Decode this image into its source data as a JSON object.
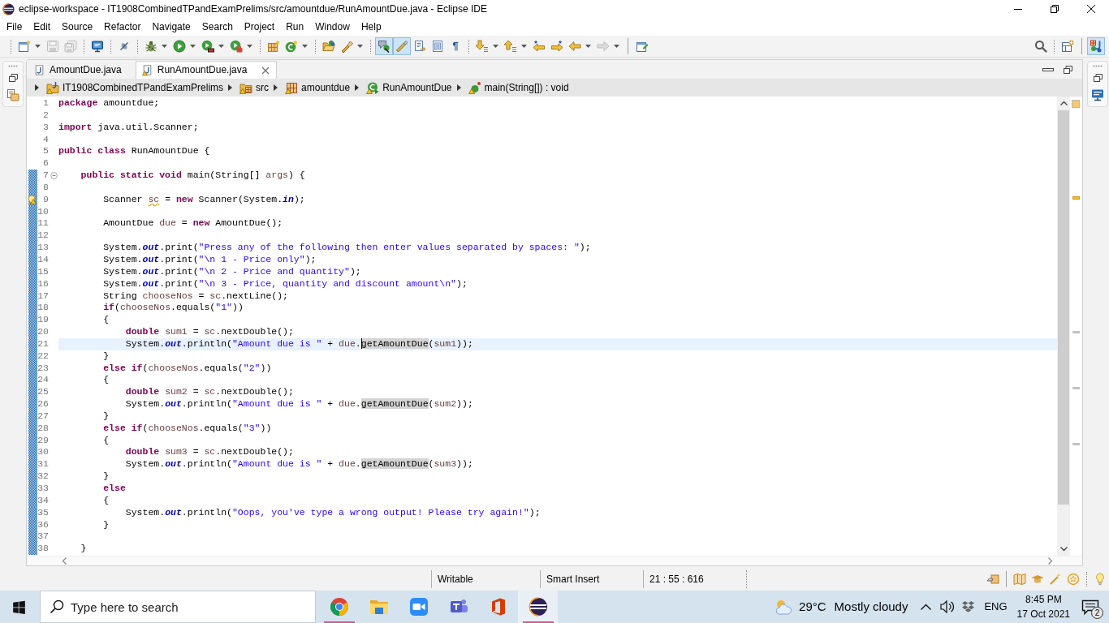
{
  "window": {
    "title": "eclipse-workspace - IT1908CombinedTPandExamPrelims/src/amountdue/RunAmountDue.java - Eclipse IDE"
  },
  "menu": [
    "File",
    "Edit",
    "Source",
    "Refactor",
    "Navigate",
    "Search",
    "Project",
    "Run",
    "Window",
    "Help"
  ],
  "toolbar": {
    "buttons": [
      {
        "kind": "icon",
        "disabled": false,
        "selected": false
      },
      {
        "kind": "icon",
        "disabled": true,
        "selected": false
      },
      {
        "kind": "icon",
        "disabled": true,
        "selected": false
      },
      {
        "kind": "icon",
        "disabled": false,
        "selected": false
      },
      {
        "kind": "icon",
        "disabled": false,
        "selected": false
      },
      {
        "kind": "icon",
        "disabled": false,
        "selected": false
      },
      {
        "kind": "icon",
        "disabled": false,
        "selected": false
      },
      {
        "kind": "icon",
        "disabled": false,
        "selected": false
      },
      {
        "kind": "icon",
        "disabled": false,
        "selected": false
      },
      {
        "kind": "icon",
        "disabled": false,
        "selected": false
      },
      {
        "kind": "icon",
        "disabled": false,
        "selected": false
      },
      {
        "kind": "icon",
        "disabled": false,
        "selected": false
      },
      {
        "kind": "icon",
        "disabled": false,
        "selected": false
      },
      {
        "kind": "icon",
        "disabled": false,
        "selected": true
      },
      {
        "kind": "icon",
        "disabled": false,
        "selected": true
      },
      {
        "kind": "icon",
        "disabled": false,
        "selected": false
      },
      {
        "kind": "icon",
        "disabled": false,
        "selected": false
      },
      {
        "kind": "glyph",
        "label": "¶",
        "disabled": false,
        "selected": false
      },
      {
        "kind": "icon",
        "disabled": false,
        "selected": false
      },
      {
        "kind": "icon",
        "disabled": false,
        "selected": false
      },
      {
        "kind": "icon",
        "disabled": false,
        "selected": false
      },
      {
        "kind": "icon",
        "disabled": false,
        "selected": false
      },
      {
        "kind": "icon",
        "disabled": false,
        "selected": false
      },
      {
        "kind": "icon",
        "disabled": true,
        "selected": false
      },
      {
        "kind": "icon",
        "disabled": false,
        "selected": false
      }
    ],
    "right_buttons": [
      {
        "kind": "icon",
        "disabled": false,
        "selected": false
      },
      {
        "kind": "icon",
        "disabled": false,
        "selected": false
      },
      {
        "kind": "icon",
        "disabled": false,
        "selected": true
      }
    ]
  },
  "editor_tabs": [
    {
      "label": "AmountDue.java",
      "selected": false,
      "warning": false
    },
    {
      "label": "RunAmountDue.java",
      "selected": true,
      "warning": true
    }
  ],
  "breadcrumb": [
    {
      "label": "IT1908CombinedTPandExamPrelims",
      "warning": true
    },
    {
      "label": "src",
      "warning": true
    },
    {
      "label": "amountdue",
      "warning": true
    },
    {
      "label": "RunAmountDue",
      "warning": true
    },
    {
      "label": "main(String[]) : void",
      "warning": true
    }
  ],
  "code": {
    "lines": [
      {
        "number": "1",
        "changed": false,
        "fold": false,
        "current": false,
        "segments": [
          {
            "kind": "keyword",
            "text": "package"
          },
          {
            "kind": "plain",
            "text": " amountdue;"
          }
        ]
      },
      {
        "number": "2",
        "changed": false,
        "fold": false,
        "current": false
      },
      {
        "number": "3",
        "changed": false,
        "fold": false,
        "current": false,
        "segments": [
          {
            "kind": "keyword",
            "text": "import"
          },
          {
            "kind": "plain",
            "text": " java.util.Scanner;"
          }
        ]
      },
      {
        "number": "4",
        "changed": false,
        "fold": false,
        "current": false
      },
      {
        "number": "5",
        "changed": false,
        "fold": false,
        "current": false,
        "segments": [
          {
            "kind": "keyword",
            "text": "public class"
          },
          {
            "kind": "plain",
            "text": " RunAmountDue {"
          }
        ]
      },
      {
        "number": "6",
        "changed": false,
        "fold": false,
        "current": false
      },
      {
        "number": "7",
        "changed": true,
        "fold": true,
        "current": false,
        "segments": [
          {
            "kind": "keyword",
            "text": "    public static void"
          },
          {
            "kind": "plain",
            "text": " main(String[] "
          },
          {
            "kind": "local",
            "text": "args"
          },
          {
            "kind": "plain",
            "text": ") {"
          }
        ]
      },
      {
        "number": "8",
        "changed": true,
        "fold": false,
        "current": false
      },
      {
        "number": "9",
        "changed": true,
        "fold": false,
        "current": false,
        "segments": [
          {
            "kind": "plain",
            "text": "        Scanner "
          },
          {
            "kind": "local_warning",
            "text": "sc"
          },
          {
            "kind": "plain",
            "text": " = "
          },
          {
            "kind": "keyword",
            "text": "new"
          },
          {
            "kind": "plain",
            "text": " Scanner(System."
          },
          {
            "kind": "field",
            "text": "in"
          },
          {
            "kind": "plain",
            "text": ");"
          }
        ]
      },
      {
        "number": "10",
        "changed": true,
        "fold": false,
        "current": false
      },
      {
        "number": "11",
        "changed": true,
        "fold": false,
        "current": false,
        "segments": [
          {
            "kind": "plain",
            "text": "        AmountDue "
          },
          {
            "kind": "local",
            "text": "due"
          },
          {
            "kind": "plain",
            "text": " = "
          },
          {
            "kind": "keyword",
            "text": "new"
          },
          {
            "kind": "plain",
            "text": " AmountDue();"
          }
        ]
      },
      {
        "number": "12",
        "changed": true,
        "fold": false,
        "current": false
      },
      {
        "number": "13",
        "changed": true,
        "fold": false,
        "current": false,
        "segments": [
          {
            "kind": "plain",
            "text": "        System."
          },
          {
            "kind": "field",
            "text": "out"
          },
          {
            "kind": "plain",
            "text": ".print("
          },
          {
            "kind": "string",
            "text": "\"Press any of the following then enter values separated by spaces: \""
          },
          {
            "kind": "plain",
            "text": ");"
          }
        ]
      },
      {
        "number": "14",
        "changed": true,
        "fold": false,
        "current": false,
        "segments": [
          {
            "kind": "plain",
            "text": "        System."
          },
          {
            "kind": "field",
            "text": "out"
          },
          {
            "kind": "plain",
            "text": ".print("
          },
          {
            "kind": "string",
            "text": "\"\\n 1 - Price only\""
          },
          {
            "kind": "plain",
            "text": ");"
          }
        ]
      },
      {
        "number": "15",
        "changed": true,
        "fold": false,
        "current": false,
        "segments": [
          {
            "kind": "plain",
            "text": "        System."
          },
          {
            "kind": "field",
            "text": "out"
          },
          {
            "kind": "plain",
            "text": ".print("
          },
          {
            "kind": "string",
            "text": "\"\\n 2 - Price and quantity\""
          },
          {
            "kind": "plain",
            "text": ");"
          }
        ]
      },
      {
        "number": "16",
        "changed": true,
        "fold": false,
        "current": false,
        "segments": [
          {
            "kind": "plain",
            "text": "        System."
          },
          {
            "kind": "field",
            "text": "out"
          },
          {
            "kind": "plain",
            "text": ".print("
          },
          {
            "kind": "string",
            "text": "\"\\n 3 - Price, quantity and discount amount\\n\""
          },
          {
            "kind": "plain",
            "text": ");"
          }
        ]
      },
      {
        "number": "17",
        "changed": true,
        "fold": false,
        "current": false,
        "segments": [
          {
            "kind": "plain",
            "text": "        String "
          },
          {
            "kind": "local",
            "text": "chooseNos"
          },
          {
            "kind": "plain",
            "text": " = "
          },
          {
            "kind": "local",
            "text": "sc"
          },
          {
            "kind": "plain",
            "text": ".nextLine();"
          }
        ]
      },
      {
        "number": "18",
        "changed": true,
        "fold": false,
        "current": false,
        "segments": [
          {
            "kind": "keyword",
            "text": "        if"
          },
          {
            "kind": "plain",
            "text": "("
          },
          {
            "kind": "local",
            "text": "chooseNos"
          },
          {
            "kind": "plain",
            "text": ".equals("
          },
          {
            "kind": "string",
            "text": "\"1\""
          },
          {
            "kind": "plain",
            "text": "))"
          }
        ]
      },
      {
        "number": "19",
        "changed": true,
        "fold": false,
        "current": false,
        "segments": [
          {
            "kind": "plain",
            "text": "        {"
          }
        ]
      },
      {
        "number": "20",
        "changed": true,
        "fold": false,
        "current": false,
        "segments": [
          {
            "kind": "keyword",
            "text": "            double "
          },
          {
            "kind": "local",
            "text": "sum1"
          },
          {
            "kind": "plain",
            "text": " = "
          },
          {
            "kind": "local",
            "text": "sc"
          },
          {
            "kind": "plain",
            "text": ".nextDouble();"
          }
        ]
      },
      {
        "number": "21",
        "changed": true,
        "fold": false,
        "current": true,
        "segments": [
          {
            "kind": "plain",
            "text": "            System."
          },
          {
            "kind": "field",
            "text": "out"
          },
          {
            "kind": "plain",
            "text": ".println("
          },
          {
            "kind": "string",
            "text": "\"Amount due is \""
          },
          {
            "kind": "plain",
            "text": " + "
          },
          {
            "kind": "local",
            "text": "due"
          },
          {
            "kind": "plain",
            "text": "."
          },
          {
            "kind": "occurrence_caret",
            "text": "getAmountDue"
          },
          {
            "kind": "plain",
            "text": "("
          },
          {
            "kind": "local",
            "text": "sum1"
          },
          {
            "kind": "plain",
            "text": "));"
          }
        ]
      },
      {
        "number": "22",
        "changed": true,
        "fold": false,
        "current": false,
        "segments": [
          {
            "kind": "plain",
            "text": "        }"
          }
        ]
      },
      {
        "number": "23",
        "changed": true,
        "fold": false,
        "current": false,
        "segments": [
          {
            "kind": "keyword",
            "text": "        else if"
          },
          {
            "kind": "plain",
            "text": "("
          },
          {
            "kind": "local",
            "text": "chooseNos"
          },
          {
            "kind": "plain",
            "text": ".equals("
          },
          {
            "kind": "string",
            "text": "\"2\""
          },
          {
            "kind": "plain",
            "text": "))"
          }
        ]
      },
      {
        "number": "24",
        "changed": true,
        "fold": false,
        "current": false,
        "segments": [
          {
            "kind": "plain",
            "text": "        {"
          }
        ]
      },
      {
        "number": "25",
        "changed": true,
        "fold": false,
        "current": false,
        "segments": [
          {
            "kind": "keyword",
            "text": "            double "
          },
          {
            "kind": "local",
            "text": "sum2"
          },
          {
            "kind": "plain",
            "text": " = "
          },
          {
            "kind": "local",
            "text": "sc"
          },
          {
            "kind": "plain",
            "text": ".nextDouble();"
          }
        ]
      },
      {
        "number": "26",
        "changed": true,
        "fold": false,
        "current": false,
        "segments": [
          {
            "kind": "plain",
            "text": "            System."
          },
          {
            "kind": "field",
            "text": "out"
          },
          {
            "kind": "plain",
            "text": ".println("
          },
          {
            "kind": "string",
            "text": "\"Amount due is \""
          },
          {
            "kind": "plain",
            "text": " + "
          },
          {
            "kind": "local",
            "text": "due"
          },
          {
            "kind": "plain",
            "text": "."
          },
          {
            "kind": "occurrence",
            "text": "getAmountDue"
          },
          {
            "kind": "plain",
            "text": "("
          },
          {
            "kind": "local",
            "text": "sum2"
          },
          {
            "kind": "plain",
            "text": "));"
          }
        ]
      },
      {
        "number": "27",
        "changed": true,
        "fold": false,
        "current": false,
        "segments": [
          {
            "kind": "plain",
            "text": "        }"
          }
        ]
      },
      {
        "number": "28",
        "changed": true,
        "fold": false,
        "current": false,
        "segments": [
          {
            "kind": "keyword",
            "text": "        else if"
          },
          {
            "kind": "plain",
            "text": "("
          },
          {
            "kind": "local",
            "text": "chooseNos"
          },
          {
            "kind": "plain",
            "text": ".equals("
          },
          {
            "kind": "string",
            "text": "\"3\""
          },
          {
            "kind": "plain",
            "text": "))"
          }
        ]
      },
      {
        "number": "29",
        "changed": true,
        "fold": false,
        "current": false,
        "segments": [
          {
            "kind": "plain",
            "text": "        {"
          }
        ]
      },
      {
        "number": "30",
        "changed": true,
        "fold": false,
        "current": false,
        "segments": [
          {
            "kind": "keyword",
            "text": "            double "
          },
          {
            "kind": "local",
            "text": "sum3"
          },
          {
            "kind": "plain",
            "text": " = "
          },
          {
            "kind": "local",
            "text": "sc"
          },
          {
            "kind": "plain",
            "text": ".nextDouble();"
          }
        ]
      },
      {
        "number": "31",
        "changed": true,
        "fold": false,
        "current": false,
        "segments": [
          {
            "kind": "plain",
            "text": "            System."
          },
          {
            "kind": "field",
            "text": "out"
          },
          {
            "kind": "plain",
            "text": ".println("
          },
          {
            "kind": "string",
            "text": "\"Amount due is \""
          },
          {
            "kind": "plain",
            "text": " + "
          },
          {
            "kind": "local",
            "text": "due"
          },
          {
            "kind": "plain",
            "text": "."
          },
          {
            "kind": "occurrence",
            "text": "getAmountDue"
          },
          {
            "kind": "plain",
            "text": "("
          },
          {
            "kind": "local",
            "text": "sum3"
          },
          {
            "kind": "plain",
            "text": "));"
          }
        ]
      },
      {
        "number": "32",
        "changed": true,
        "fold": false,
        "current": false,
        "segments": [
          {
            "kind": "plain",
            "text": "        }"
          }
        ]
      },
      {
        "number": "33",
        "changed": true,
        "fold": false,
        "current": false,
        "segments": [
          {
            "kind": "keyword",
            "text": "        else"
          }
        ]
      },
      {
        "number": "34",
        "changed": true,
        "fold": false,
        "current": false,
        "segments": [
          {
            "kind": "plain",
            "text": "        {"
          }
        ]
      },
      {
        "number": "35",
        "changed": true,
        "fold": false,
        "current": false,
        "segments": [
          {
            "kind": "plain",
            "text": "            System."
          },
          {
            "kind": "field",
            "text": "out"
          },
          {
            "kind": "plain",
            "text": ".println("
          },
          {
            "kind": "string",
            "text": "\"Oops, you've type a wrong output! Please try again!\""
          },
          {
            "kind": "plain",
            "text": ");"
          }
        ]
      },
      {
        "number": "36",
        "changed": true,
        "fold": false,
        "current": false,
        "segments": [
          {
            "kind": "plain",
            "text": "        }"
          }
        ]
      },
      {
        "number": "37",
        "changed": true,
        "fold": false,
        "current": false
      },
      {
        "number": "38",
        "changed": true,
        "fold": false,
        "current": false,
        "segments": [
          {
            "kind": "plain",
            "text": "    }"
          }
        ]
      }
    ]
  },
  "status_bar": {
    "fields": [
      "Writable",
      "Smart Insert",
      "21 : 55 : 616"
    ]
  },
  "taskbar": {
    "search": {
      "placeholder": "Type here to search"
    },
    "apps": [
      {
        "running": true,
        "active": false
      },
      {
        "running": false,
        "active": false
      },
      {
        "running": false,
        "active": false
      },
      {
        "running": false,
        "active": false
      },
      {
        "running": false,
        "active": false
      },
      {
        "running": true,
        "active": true
      }
    ],
    "weather": {
      "temperature": "29°C",
      "condition": "Mostly cloudy"
    },
    "language": "ENG",
    "time": "8:45 PM",
    "date": "17 Oct 2021",
    "notification_count": "2"
  }
}
